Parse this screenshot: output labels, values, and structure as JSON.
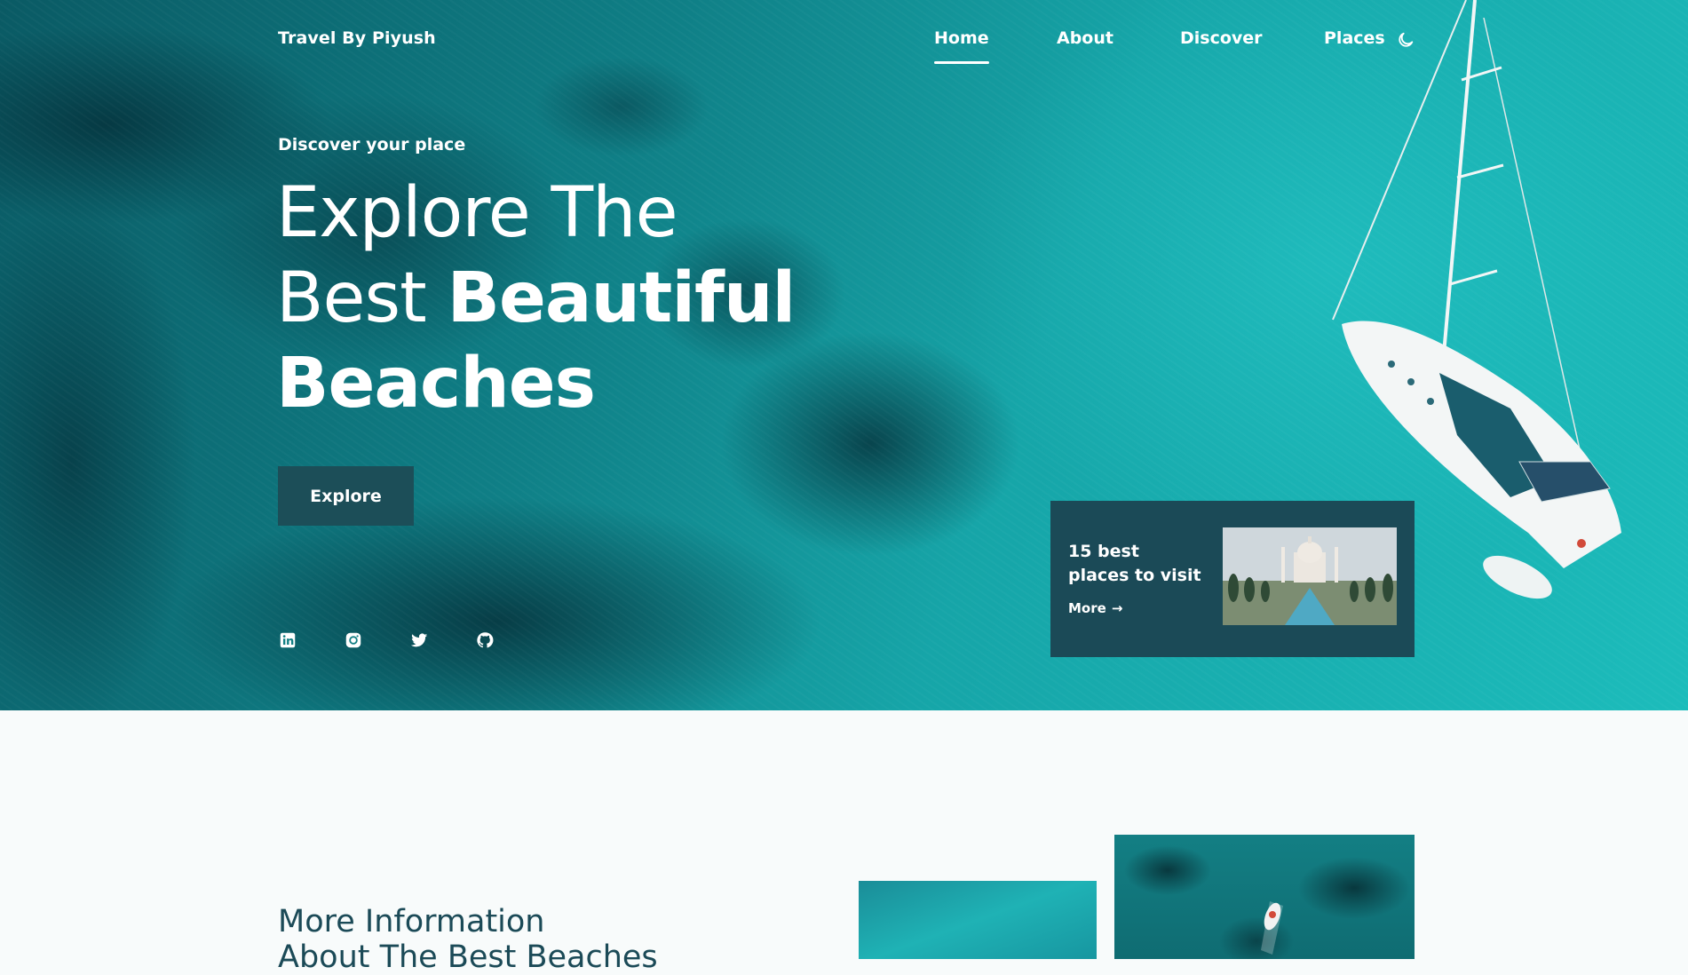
{
  "brand": {
    "name": "Travel By Piyush"
  },
  "nav": {
    "items": [
      {
        "label": "Home",
        "active": true
      },
      {
        "label": "About",
        "active": false
      },
      {
        "label": "Discover",
        "active": false
      },
      {
        "label": "Places",
        "active": false
      }
    ],
    "theme_icon": "moon-icon"
  },
  "hero": {
    "subtitle": "Discover your place",
    "headline": {
      "line1": "Explore The",
      "line2_regular": "Best ",
      "line2_bold": "Beautiful",
      "line3_bold": "Beaches"
    },
    "cta_label": "Explore",
    "socials": [
      "linkedin-icon",
      "instagram-icon",
      "twitter-icon",
      "github-icon"
    ]
  },
  "promo": {
    "title": "15 best places to visit",
    "more_label": "More",
    "arrow_icon": "arrow-right-icon",
    "image": "taj-mahal-image"
  },
  "info": {
    "title_line1": "More Information",
    "title_line2": "About The Best Beaches"
  },
  "colors": {
    "accent": "#1b4a57",
    "text_on_hero": "#ffffff",
    "sea": "#16a5a8"
  }
}
